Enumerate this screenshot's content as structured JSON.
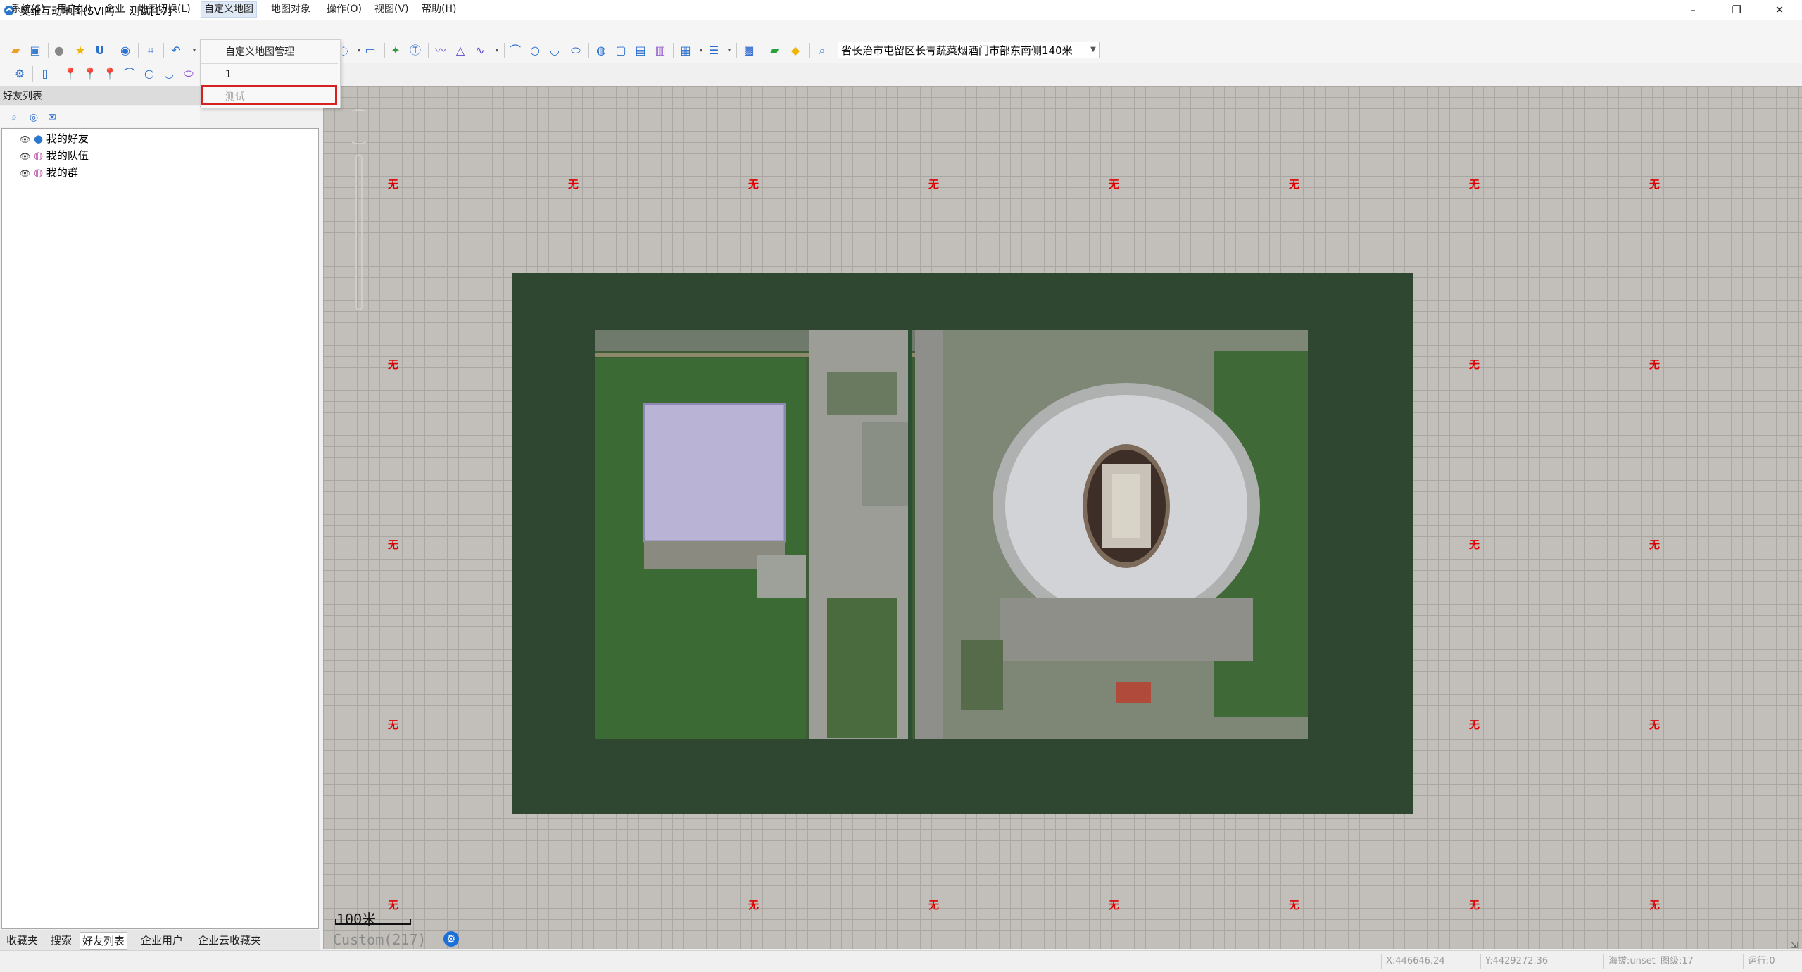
{
  "window": {
    "title": "奥维互动地图(SVIP) -- 测试[17]",
    "minimize": "–",
    "restore": "❐",
    "close": "✕"
  },
  "menu": [
    {
      "label": "系统(S)"
    },
    {
      "label": "用户(U)"
    },
    {
      "label": "企业"
    },
    {
      "label": "地图切换(L)"
    },
    {
      "label": "自定义地图"
    },
    {
      "label": "地图对象"
    },
    {
      "label": "操作(O)"
    },
    {
      "label": "视图(V)"
    },
    {
      "label": "帮助(H)"
    }
  ],
  "dropdown": {
    "items": [
      "自定义地图管理",
      "1",
      "测试"
    ]
  },
  "search": {
    "address": "省长治市屯留区长青蔬菜烟酒门市部东南侧140米"
  },
  "left_panel": {
    "title": "好友列表",
    "tree": [
      "我的好友",
      "我的队伍",
      "我的群"
    ]
  },
  "bottom_tabs": [
    "收藏夹",
    "搜索",
    "好友列表",
    "企业用户",
    "企业云收藏夹"
  ],
  "map": {
    "placeholder_label": "无",
    "scale_label": "100米",
    "map_name": "Custom(217)",
    "overlay_color": "#2f4730",
    "grid_color": "#c2bfba"
  },
  "status": {
    "x": "X:446646.24",
    "y": "Y:4429272.36",
    "altitude": "海拔:unset",
    "level": "图级:17",
    "running": "运行:0"
  },
  "colors": {
    "accent": "#d42222",
    "brand": "#1b6fd6"
  }
}
